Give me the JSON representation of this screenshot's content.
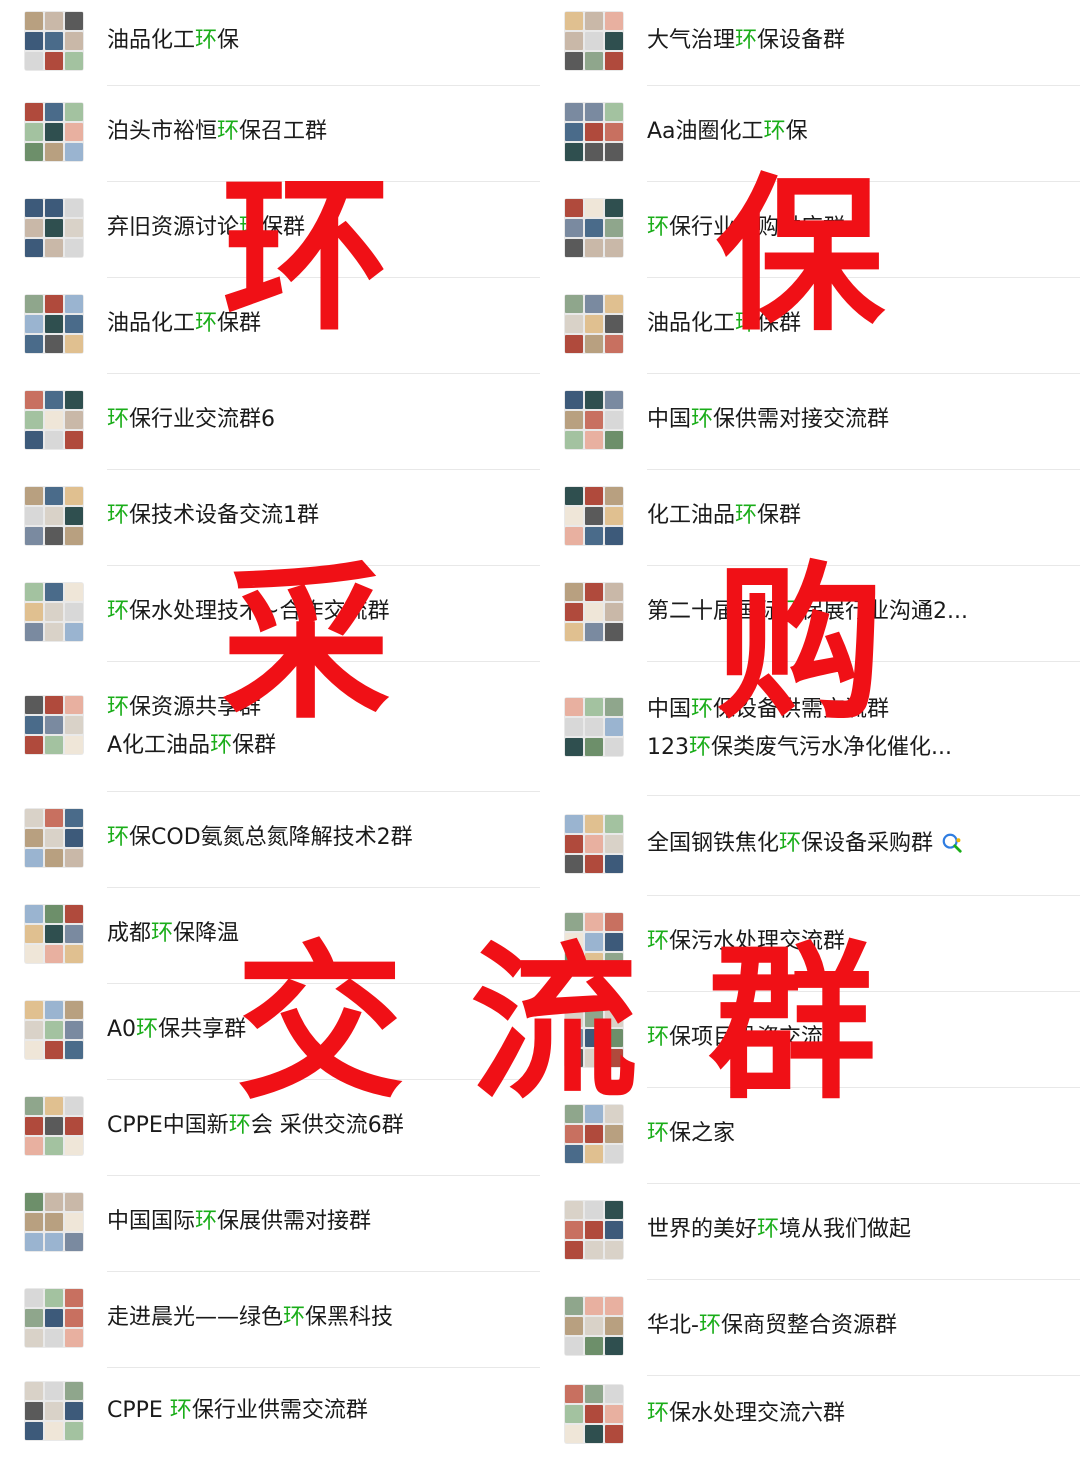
{
  "left_column": [
    {
      "parts": [
        "油品化工",
        "环",
        "保"
      ]
    },
    {
      "parts": [
        "泊头市裕恒",
        "环",
        "保召工群"
      ]
    },
    {
      "parts": [
        "弃旧资源讨论",
        "环",
        "保群"
      ]
    },
    {
      "parts": [
        "油品化工",
        "环",
        "保群"
      ]
    },
    {
      "parts": [
        "",
        "环",
        "保行业交流群6"
      ]
    },
    {
      "parts": [
        "",
        "环",
        "保技术设备交流1群"
      ]
    },
    {
      "parts": [
        "",
        "环",
        "保水处理技术~合作交流群"
      ]
    },
    {
      "lines": [
        [
          "",
          "环",
          "保资源共享群"
        ],
        [
          "A化工油品",
          "环",
          "保群"
        ]
      ]
    },
    {
      "parts": [
        "",
        "环",
        "保COD氨氮总氮降解技术2群"
      ]
    },
    {
      "parts": [
        "成都",
        "环",
        "保降温"
      ]
    },
    {
      "parts": [
        "A0",
        "环",
        "保共享群"
      ]
    },
    {
      "parts": [
        "CPPE中国新",
        "环",
        "会 采供交流6群"
      ]
    },
    {
      "parts": [
        "中国国际",
        "环",
        "保展供需对接群"
      ]
    },
    {
      "parts": [
        "走进晨光——绿色",
        "环",
        "保黑科技"
      ]
    },
    {
      "parts": [
        "CPPE ",
        "环",
        "保行业供需交流群"
      ]
    }
  ],
  "right_column": [
    {
      "parts": [
        "大气治理",
        "环",
        "保设备群"
      ]
    },
    {
      "parts": [
        "Aa油圈化工",
        "环",
        "保"
      ]
    },
    {
      "parts": [
        "",
        "环",
        "保行业采购供应群"
      ]
    },
    {
      "parts": [
        "油品化工",
        "环",
        "保群"
      ]
    },
    {
      "parts": [
        "中国",
        "环",
        "保供需对接交流群"
      ]
    },
    {
      "parts": [
        "化工油品",
        "环",
        "保群"
      ]
    },
    {
      "parts": [
        "第二十届国际",
        "环",
        "保展行业沟通2..."
      ]
    },
    {
      "lines": [
        [
          "中国",
          "环",
          "保设备供需交流群"
        ],
        [
          "123",
          "环",
          "保类废气污水净化催化..."
        ]
      ]
    },
    {
      "parts": [
        "全国钢铁焦化",
        "环",
        "保设备采购群"
      ],
      "badge": "search-chat-icon"
    },
    {
      "parts": [
        "",
        "环",
        "保污水处理交流群"
      ]
    },
    {
      "parts": [
        "",
        "环",
        "保项目投资交流"
      ]
    },
    {
      "parts": [
        "",
        "环",
        "保之家"
      ]
    },
    {
      "parts": [
        "世界的美好",
        "环",
        "境从我们做起"
      ]
    },
    {
      "parts": [
        "华北-",
        "环",
        "保商贸整合资源群"
      ]
    },
    {
      "parts": [
        "",
        "环",
        "保水处理交流六群"
      ]
    }
  ],
  "overlay_text": {
    "huan": "环",
    "bao": "保",
    "cai": "采",
    "gou": "购",
    "jiao": "交",
    "liu": "流",
    "qun": "群"
  },
  "colors": {
    "highlight": "#1aad19",
    "overlay": "#f01016",
    "divider": "#e8e8e8"
  }
}
